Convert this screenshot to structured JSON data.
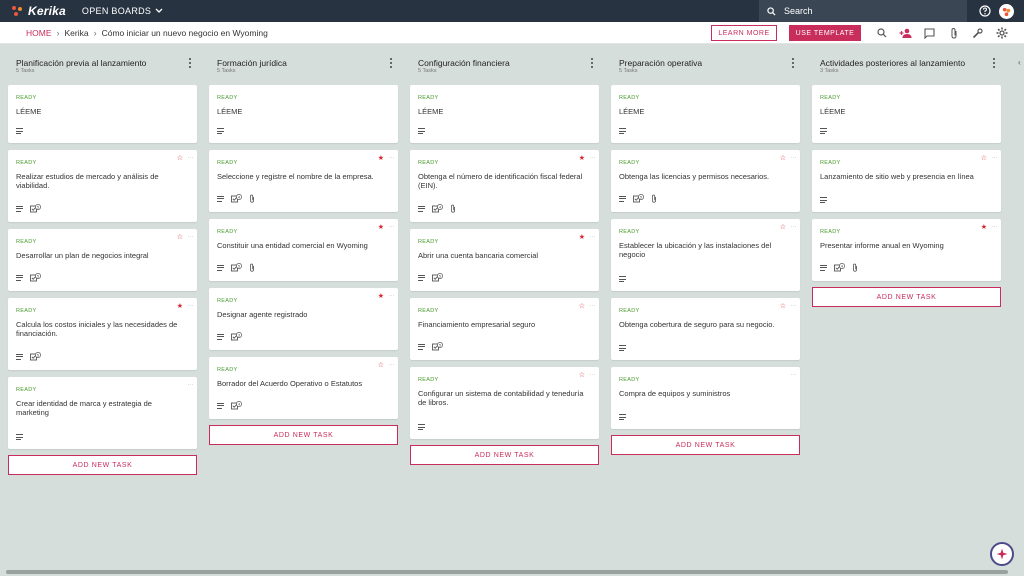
{
  "app": {
    "name": "Kerika",
    "open_boards": "OPEN BOARDS"
  },
  "search": {
    "label": "Search"
  },
  "breadcrumb": [
    "HOME",
    "Kerika",
    "Cómo iniciar un nuevo negocio en Wyoming"
  ],
  "actions": {
    "learn_more": "LEARN MORE",
    "use_template": "USE TEMPLATE"
  },
  "add_task_label": "ADD NEW TASK",
  "colors": {
    "accent": "#c92d5c",
    "ready": "#4a9b2f",
    "star": "#d9262f",
    "topbar": "#283342"
  },
  "columns": [
    {
      "title": "Planificación previa al lanzamiento",
      "count": "5 Tasks",
      "cards": [
        {
          "status": "READY",
          "title": "LÉEME",
          "star": "none",
          "checklist": false,
          "checklist_count": "",
          "attachment": false
        },
        {
          "status": "READY",
          "title": "Realizar estudios de mercado y análisis de viabilidad.",
          "star": "empty",
          "checklist": true,
          "checklist_count": "5",
          "attachment": false
        },
        {
          "status": "READY",
          "title": "Desarrollar un plan de negocios integral",
          "star": "empty",
          "checklist": true,
          "checklist_count": "5",
          "attachment": false
        },
        {
          "status": "READY",
          "title": "Calcula los costos iniciales y las necesidades de financiación.",
          "star": "filled",
          "checklist": true,
          "checklist_count": "5",
          "attachment": false
        },
        {
          "status": "READY",
          "title": "Crear identidad de marca y estrategia de marketing",
          "star": "none",
          "checklist": false,
          "checklist_count": "",
          "attachment": false
        }
      ]
    },
    {
      "title": "Formación jurídica",
      "count": "5 Tasks",
      "cards": [
        {
          "status": "READY",
          "title": "LÉEME",
          "star": "none",
          "checklist": false,
          "checklist_count": "",
          "attachment": false
        },
        {
          "status": "READY",
          "title": "Seleccione y registre el nombre de la empresa.",
          "star": "filled",
          "checklist": true,
          "checklist_count": "4",
          "attachment": true
        },
        {
          "status": "READY",
          "title": "Constituir una entidad comercial en Wyoming",
          "star": "filled",
          "checklist": true,
          "checklist_count": "5",
          "attachment": true
        },
        {
          "status": "READY",
          "title": "Designar agente registrado",
          "star": "filled",
          "checklist": true,
          "checklist_count": "3",
          "attachment": false
        },
        {
          "status": "READY",
          "title": "Borrador del Acuerdo Operativo o Estatutos",
          "star": "empty",
          "checklist": true,
          "checklist_count": "4",
          "attachment": false
        }
      ]
    },
    {
      "title": "Configuración financiera",
      "count": "5 Tasks",
      "cards": [
        {
          "status": "READY",
          "title": "LÉEME",
          "star": "none",
          "checklist": false,
          "checklist_count": "",
          "attachment": false
        },
        {
          "status": "READY",
          "title": "Obtenga el número de identificación fiscal federal (EIN).",
          "star": "filled",
          "checklist": true,
          "checklist_count": "4",
          "attachment": true
        },
        {
          "status": "READY",
          "title": "Abrir una cuenta bancaria comercial",
          "star": "filled",
          "checklist": true,
          "checklist_count": "5",
          "attachment": false
        },
        {
          "status": "READY",
          "title": "Financiamiento empresarial seguro",
          "star": "empty",
          "checklist": true,
          "checklist_count": "5",
          "attachment": false
        },
        {
          "status": "READY",
          "title": "Configurar un sistema de contabilidad y teneduría de libros.",
          "star": "empty",
          "checklist": false,
          "checklist_count": "",
          "attachment": false
        }
      ]
    },
    {
      "title": "Preparación operativa",
      "count": "5 Tasks",
      "cards": [
        {
          "status": "READY",
          "title": "LÉEME",
          "star": "none",
          "checklist": false,
          "checklist_count": "",
          "attachment": false
        },
        {
          "status": "READY",
          "title": "Obtenga las licencias y permisos necesarios.",
          "star": "empty",
          "checklist": true,
          "checklist_count": "5",
          "attachment": true
        },
        {
          "status": "READY",
          "title": "Establecer la ubicación y las instalaciones del negocio",
          "star": "empty",
          "checklist": false,
          "checklist_count": "",
          "attachment": false
        },
        {
          "status": "READY",
          "title": "Obtenga cobertura de seguro para su negocio.",
          "star": "empty",
          "checklist": false,
          "checklist_count": "",
          "attachment": false
        },
        {
          "status": "READY",
          "title": "Compra de equipos y suministros",
          "star": "none",
          "checklist": false,
          "checklist_count": "",
          "attachment": false
        }
      ]
    },
    {
      "title": "Actividades posteriores al lanzamiento",
      "count": "3 Tasks",
      "cards": [
        {
          "status": "READY",
          "title": "LÉEME",
          "star": "none",
          "checklist": false,
          "checklist_count": "",
          "attachment": false
        },
        {
          "status": "READY",
          "title": "Lanzamiento de sitio web y presencia en línea",
          "star": "empty",
          "checklist": false,
          "checklist_count": "",
          "attachment": false
        },
        {
          "status": "READY",
          "title": "Presentar informe anual en Wyoming",
          "star": "filled",
          "checklist": true,
          "checklist_count": "4",
          "attachment": true
        }
      ]
    }
  ],
  "icons": {
    "search": "search-icon",
    "help": "help-icon",
    "avatar": "avatar",
    "zoom": "search-icon",
    "add_person": "add-person-icon",
    "chat": "chat-icon",
    "attach": "paperclip-icon",
    "tools": "wrench-icon",
    "settings": "gear-icon"
  }
}
